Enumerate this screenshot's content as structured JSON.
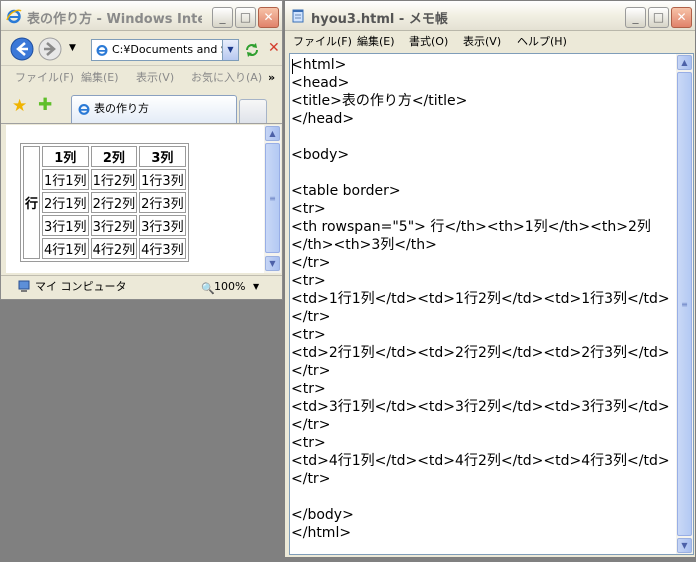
{
  "ie": {
    "title": "表の作り方 - Windows Inte...",
    "address": "C:¥Documents and S",
    "menu": [
      "ファイル(F)",
      "編集(E)",
      "表示(V)",
      "お気に入り(A)"
    ],
    "menu_more": "»",
    "tab_title": "表の作り方",
    "table": {
      "row_header": "行",
      "col_headers": [
        "1列",
        "2列",
        "3列"
      ],
      "rows": [
        [
          "1行1列",
          "1行2列",
          "1行3列"
        ],
        [
          "2行1列",
          "2行2列",
          "2行3列"
        ],
        [
          "3行1列",
          "3行2列",
          "3行3列"
        ],
        [
          "4行1列",
          "4行2列",
          "4行3列"
        ]
      ]
    },
    "status_zone": "マイ コンピュータ",
    "zoom": "100%"
  },
  "notepad": {
    "title": "hyou3.html - メモ帳",
    "menu": [
      "ファイル(F)",
      "編集(E)",
      "書式(O)",
      "表示(V)",
      "ヘルプ(H)"
    ],
    "lines": [
      "<html>",
      "<head>",
      "<title>表の作り方</title>",
      "</head>",
      "",
      "<body>",
      "",
      "<table border>",
      "<tr>",
      "<th rowspan=\"5\"> 行</th><th>1列</th><th>2列",
      "</th><th>3列</th>",
      "</tr>",
      "<tr>",
      "<td>1行1列</td><td>1行2列</td><td>1行3列</td>",
      "</tr>",
      "<tr>",
      "<td>2行1列</td><td>2行2列</td><td>2行3列</td>",
      "</tr>",
      "<tr>",
      "<td>3行1列</td><td>3行2列</td><td>3行3列</td>",
      "</tr>",
      "<tr>",
      "<td>4行1列</td><td>4行2列</td><td>4行3列</td>",
      "</tr>",
      "",
      "</body>",
      "</html>"
    ]
  },
  "window_buttons": {
    "minimize": "_",
    "maximize": "□",
    "close": "✕"
  },
  "colors": {
    "ie_blue": "#2b7ad6",
    "xp_close": "#e0826a",
    "desktop": "#808080"
  }
}
